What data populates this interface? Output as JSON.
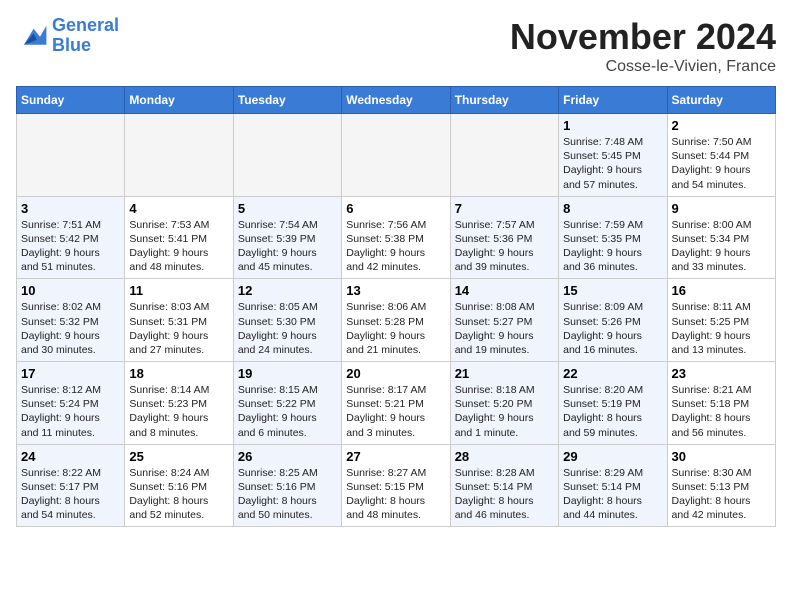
{
  "header": {
    "logo_line1": "General",
    "logo_line2": "Blue",
    "month": "November 2024",
    "location": "Cosse-le-Vivien, France"
  },
  "weekdays": [
    "Sunday",
    "Monday",
    "Tuesday",
    "Wednesday",
    "Thursday",
    "Friday",
    "Saturday"
  ],
  "weeks": [
    [
      {
        "day": "",
        "info": "",
        "empty": true
      },
      {
        "day": "",
        "info": "",
        "empty": true
      },
      {
        "day": "",
        "info": "",
        "empty": true
      },
      {
        "day": "",
        "info": "",
        "empty": true
      },
      {
        "day": "",
        "info": "",
        "empty": true
      },
      {
        "day": "1",
        "info": "Sunrise: 7:48 AM\nSunset: 5:45 PM\nDaylight: 9 hours\nand 57 minutes.",
        "shaded": true
      },
      {
        "day": "2",
        "info": "Sunrise: 7:50 AM\nSunset: 5:44 PM\nDaylight: 9 hours\nand 54 minutes."
      }
    ],
    [
      {
        "day": "3",
        "info": "Sunrise: 7:51 AM\nSunset: 5:42 PM\nDaylight: 9 hours\nand 51 minutes.",
        "shaded": true
      },
      {
        "day": "4",
        "info": "Sunrise: 7:53 AM\nSunset: 5:41 PM\nDaylight: 9 hours\nand 48 minutes."
      },
      {
        "day": "5",
        "info": "Sunrise: 7:54 AM\nSunset: 5:39 PM\nDaylight: 9 hours\nand 45 minutes.",
        "shaded": true
      },
      {
        "day": "6",
        "info": "Sunrise: 7:56 AM\nSunset: 5:38 PM\nDaylight: 9 hours\nand 42 minutes."
      },
      {
        "day": "7",
        "info": "Sunrise: 7:57 AM\nSunset: 5:36 PM\nDaylight: 9 hours\nand 39 minutes.",
        "shaded": true
      },
      {
        "day": "8",
        "info": "Sunrise: 7:59 AM\nSunset: 5:35 PM\nDaylight: 9 hours\nand 36 minutes.",
        "shaded": true
      },
      {
        "day": "9",
        "info": "Sunrise: 8:00 AM\nSunset: 5:34 PM\nDaylight: 9 hours\nand 33 minutes."
      }
    ],
    [
      {
        "day": "10",
        "info": "Sunrise: 8:02 AM\nSunset: 5:32 PM\nDaylight: 9 hours\nand 30 minutes.",
        "shaded": true
      },
      {
        "day": "11",
        "info": "Sunrise: 8:03 AM\nSunset: 5:31 PM\nDaylight: 9 hours\nand 27 minutes."
      },
      {
        "day": "12",
        "info": "Sunrise: 8:05 AM\nSunset: 5:30 PM\nDaylight: 9 hours\nand 24 minutes.",
        "shaded": true
      },
      {
        "day": "13",
        "info": "Sunrise: 8:06 AM\nSunset: 5:28 PM\nDaylight: 9 hours\nand 21 minutes."
      },
      {
        "day": "14",
        "info": "Sunrise: 8:08 AM\nSunset: 5:27 PM\nDaylight: 9 hours\nand 19 minutes.",
        "shaded": true
      },
      {
        "day": "15",
        "info": "Sunrise: 8:09 AM\nSunset: 5:26 PM\nDaylight: 9 hours\nand 16 minutes.",
        "shaded": true
      },
      {
        "day": "16",
        "info": "Sunrise: 8:11 AM\nSunset: 5:25 PM\nDaylight: 9 hours\nand 13 minutes."
      }
    ],
    [
      {
        "day": "17",
        "info": "Sunrise: 8:12 AM\nSunset: 5:24 PM\nDaylight: 9 hours\nand 11 minutes.",
        "shaded": true
      },
      {
        "day": "18",
        "info": "Sunrise: 8:14 AM\nSunset: 5:23 PM\nDaylight: 9 hours\nand 8 minutes."
      },
      {
        "day": "19",
        "info": "Sunrise: 8:15 AM\nSunset: 5:22 PM\nDaylight: 9 hours\nand 6 minutes.",
        "shaded": true
      },
      {
        "day": "20",
        "info": "Sunrise: 8:17 AM\nSunset: 5:21 PM\nDaylight: 9 hours\nand 3 minutes."
      },
      {
        "day": "21",
        "info": "Sunrise: 8:18 AM\nSunset: 5:20 PM\nDaylight: 9 hours\nand 1 minute.",
        "shaded": true
      },
      {
        "day": "22",
        "info": "Sunrise: 8:20 AM\nSunset: 5:19 PM\nDaylight: 8 hours\nand 59 minutes.",
        "shaded": true
      },
      {
        "day": "23",
        "info": "Sunrise: 8:21 AM\nSunset: 5:18 PM\nDaylight: 8 hours\nand 56 minutes."
      }
    ],
    [
      {
        "day": "24",
        "info": "Sunrise: 8:22 AM\nSunset: 5:17 PM\nDaylight: 8 hours\nand 54 minutes.",
        "shaded": true
      },
      {
        "day": "25",
        "info": "Sunrise: 8:24 AM\nSunset: 5:16 PM\nDaylight: 8 hours\nand 52 minutes."
      },
      {
        "day": "26",
        "info": "Sunrise: 8:25 AM\nSunset: 5:16 PM\nDaylight: 8 hours\nand 50 minutes.",
        "shaded": true
      },
      {
        "day": "27",
        "info": "Sunrise: 8:27 AM\nSunset: 5:15 PM\nDaylight: 8 hours\nand 48 minutes."
      },
      {
        "day": "28",
        "info": "Sunrise: 8:28 AM\nSunset: 5:14 PM\nDaylight: 8 hours\nand 46 minutes.",
        "shaded": true
      },
      {
        "day": "29",
        "info": "Sunrise: 8:29 AM\nSunset: 5:14 PM\nDaylight: 8 hours\nand 44 minutes.",
        "shaded": true
      },
      {
        "day": "30",
        "info": "Sunrise: 8:30 AM\nSunset: 5:13 PM\nDaylight: 8 hours\nand 42 minutes."
      }
    ]
  ]
}
